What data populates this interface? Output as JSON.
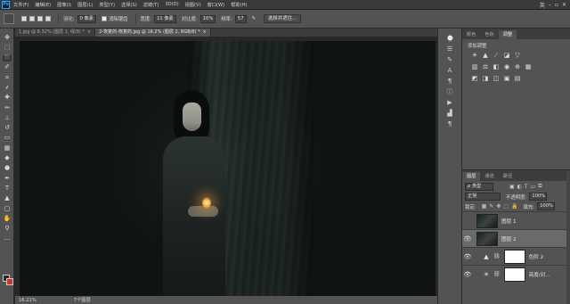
{
  "menubar": {
    "logo": "Ps",
    "items": [
      "文件(F)",
      "编辑(E)",
      "图像(I)",
      "图层(L)",
      "类型(Y)",
      "选择(S)",
      "滤镜(T)",
      "3D(D)",
      "视图(V)",
      "窗口(W)",
      "帮助(H)"
    ],
    "right_label": "英"
  },
  "options": {
    "feather_label": "羽化:",
    "feather_value": "0 像素",
    "antialias_label": "消除锯齿",
    "width_label": "宽度:",
    "width_value": "11 像素",
    "contrast_label": "对比度:",
    "contrast_value": "10%",
    "frequency_label": "频率:",
    "frequency_value": "57",
    "select_mask_button": "选择并遮住..."
  },
  "document": {
    "tabs": [
      {
        "label": "1.jpg @ 8.32% (图层 1, 绿/8) *",
        "active": false
      },
      {
        "label": "2-恢复的-恢复的.jpg @ 16.2% (图层 2, RGB/8) *",
        "active": true
      }
    ],
    "status": {
      "zoom": "16.21%",
      "info": "7个图层"
    }
  },
  "adjustments_panel": {
    "tabs": [
      "颜色",
      "色板",
      "调整"
    ],
    "active_tab": "调整",
    "title": "添加调整"
  },
  "layers_panel": {
    "tabs": [
      "图层",
      "通道",
      "路径"
    ],
    "active_tab": "图层",
    "filter_kind": "ρ 类型",
    "blend_mode": "正常",
    "opacity_label": "不透明度:",
    "opacity_value": "100%",
    "lock_label": "锁定:",
    "fill_label": "填充:",
    "fill_value": "100%",
    "layers": [
      {
        "name": "图层 1",
        "visible": false,
        "selected": false,
        "type": "pixel"
      },
      {
        "name": "图层 2",
        "visible": true,
        "selected": true,
        "type": "pixel"
      },
      {
        "name": "色阶 2",
        "visible": true,
        "selected": false,
        "type": "levels"
      },
      {
        "name": "亮度/对...",
        "visible": true,
        "selected": false,
        "type": "brightness"
      }
    ]
  }
}
